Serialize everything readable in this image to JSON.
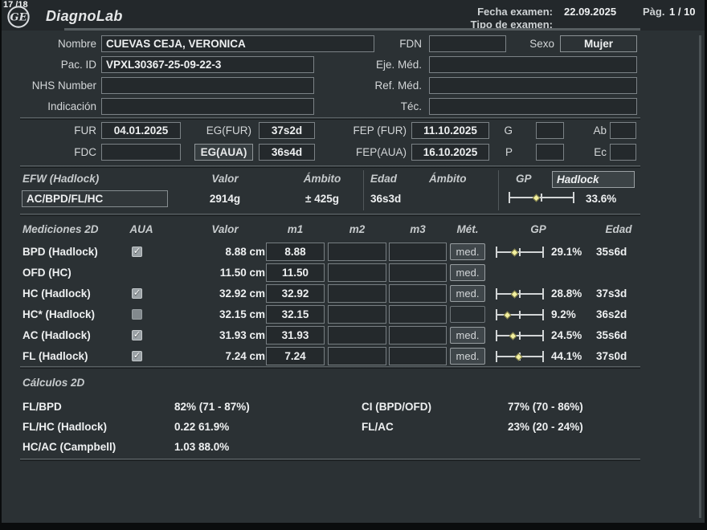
{
  "header": {
    "counter": "17 /18",
    "app_title": "DiagnoLab",
    "exam_date_label": "Fecha examen:",
    "exam_date": "22.09.2025",
    "page_label": "Pàg.",
    "page_value": "1 / 10",
    "exam_type_label": "Tipo de examen:"
  },
  "patient": {
    "nombre_label": "Nombre",
    "nombre": "CUEVAS CEJA, VERONICA",
    "pac_id_label": "Pac. ID",
    "pac_id": "VPXL30367-25-09-22-3",
    "nhs_label": "NHS Number",
    "nhs": "",
    "indicacion_label": "Indicación",
    "indicacion": "",
    "fdn_label": "FDN",
    "fdn": "",
    "sexo_label": "Sexo",
    "sexo": "Mujer",
    "eje_med_label": "Eje. Méd.",
    "eje_med": "",
    "ref_med_label": "Ref. Méd.",
    "ref_med": "",
    "tec_label": "Téc.",
    "tec": ""
  },
  "dates": {
    "fur_label": "FUR",
    "fur": "04.01.2025",
    "fdc_label": "FDC",
    "fdc": "",
    "eg_fur_label": "EG(FUR)",
    "eg_fur": "37s2d",
    "eg_aua_label": "EG(AUA)",
    "eg_aua": "36s4d",
    "fep_fur_label": "FEP (FUR)",
    "fep_fur": "11.10.2025",
    "fep_aua_label": "FEP(AUA)",
    "fep_aua": "16.10.2025",
    "g_label": "G",
    "g": "",
    "p_label": "P",
    "p": "",
    "ab_label": "Ab",
    "ab": "",
    "ec_label": "Ec",
    "ec": ""
  },
  "efw": {
    "title": "EFW (Hadlock)",
    "col_valor": "Valor",
    "col_ambito": "Ámbito",
    "col_edad": "Edad",
    "col_ambito2": "Ámbito",
    "col_gp": "GP",
    "method": "Hadlock",
    "formula": "AC/BPD/FL/HC",
    "valor": "2914g",
    "ambito": "± 425g",
    "edad": "36s3d",
    "gp_percent": 33.6,
    "gp_text": "33.6%"
  },
  "measurements": {
    "title": "Mediciones 2D",
    "col_aua": "AUA",
    "col_valor": "Valor",
    "col_m1": "m1",
    "col_m2": "m2",
    "col_m3": "m3",
    "col_met": "Mét.",
    "col_gp": "GP",
    "col_edad": "Edad",
    "rows": [
      {
        "label": "BPD (Hadlock)",
        "aua": "checked",
        "valor": "8.88 cm",
        "m1": "8.88",
        "m2": "",
        "m3": "",
        "met": "med.",
        "gp_percent": 29.1,
        "gp_text": "29.1%",
        "edad": "35s6d"
      },
      {
        "label": "OFD (HC)",
        "aua": "none",
        "valor": "11.50 cm",
        "m1": "11.50",
        "m2": "",
        "m3": "",
        "met": "med.",
        "gp_percent": null,
        "gp_text": "",
        "edad": ""
      },
      {
        "label": "HC (Hadlock)",
        "aua": "checked",
        "valor": "32.92 cm",
        "m1": "32.92",
        "m2": "",
        "m3": "",
        "met": "med.",
        "gp_percent": 28.8,
        "gp_text": "28.8%",
        "edad": "37s3d"
      },
      {
        "label": "HC* (Hadlock)",
        "aua": "unchecked",
        "valor": "32.15 cm",
        "m1": "32.15",
        "m2": "",
        "m3": "",
        "met": "",
        "gp_percent": 9.2,
        "gp_text": "9.2%",
        "edad": "36s2d"
      },
      {
        "label": "AC (Hadlock)",
        "aua": "checked",
        "valor": "31.93 cm",
        "m1": "31.93",
        "m2": "",
        "m3": "",
        "met": "med.",
        "gp_percent": 24.5,
        "gp_text": "24.5%",
        "edad": "35s6d"
      },
      {
        "label": "FL (Hadlock)",
        "aua": "checked",
        "valor": "7.24 cm",
        "m1": "7.24",
        "m2": "",
        "m3": "",
        "met": "med.",
        "gp_percent": 44.1,
        "gp_text": "44.1%",
        "edad": "37s0d"
      }
    ]
  },
  "calculations": {
    "title": "Cálculos 2D",
    "left": [
      {
        "label": "FL/BPD",
        "value": "82% (71 - 87%)"
      },
      {
        "label": "FL/HC (Hadlock)",
        "value": "0.22 61.9%"
      },
      {
        "label": "HC/AC (Campbell)",
        "value": "1.03 88.0%"
      }
    ],
    "right": [
      {
        "label": "CI (BPD/OFD)",
        "value": "77% (70 - 86%)"
      },
      {
        "label": "FL/AC",
        "value": "23% (20 - 24%)"
      }
    ]
  },
  "colors": {
    "background": "#2b3134",
    "topbar": "#23282b",
    "accent_yellow": "#f2f0a0",
    "chart_line": "#d2d5d6"
  }
}
